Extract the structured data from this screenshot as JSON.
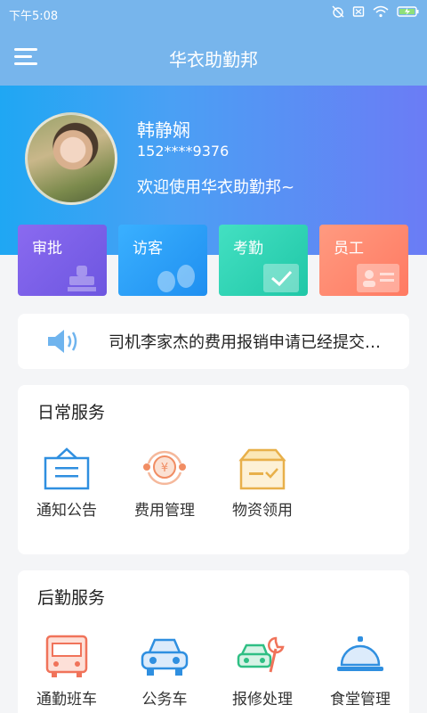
{
  "status": {
    "time": "下午5:08"
  },
  "header": {
    "title": "华衣助勤邦"
  },
  "profile": {
    "name": "韩静娴",
    "phone": "152****9376",
    "welcome": "欢迎使用华衣助勤邦~"
  },
  "quick_actions": [
    {
      "label": "审批",
      "color": "#7f62e8"
    },
    {
      "label": "访客",
      "color": "#2d9ff5"
    },
    {
      "label": "考勤",
      "color": "#2fd4b7"
    },
    {
      "label": "员工",
      "color": "#ff8a6c"
    }
  ],
  "notice": {
    "text": "司机李家杰的费用报销申请已经提交，请尽快审批"
  },
  "daily": {
    "title": "日常服务",
    "items": [
      {
        "label": "通知公告"
      },
      {
        "label": "费用管理"
      },
      {
        "label": "物资领用"
      }
    ]
  },
  "logistics": {
    "title": "后勤服务",
    "items": [
      {
        "label": "通勤班车"
      },
      {
        "label": "公务车"
      },
      {
        "label": "报修处理"
      },
      {
        "label": "食堂管理"
      }
    ]
  }
}
